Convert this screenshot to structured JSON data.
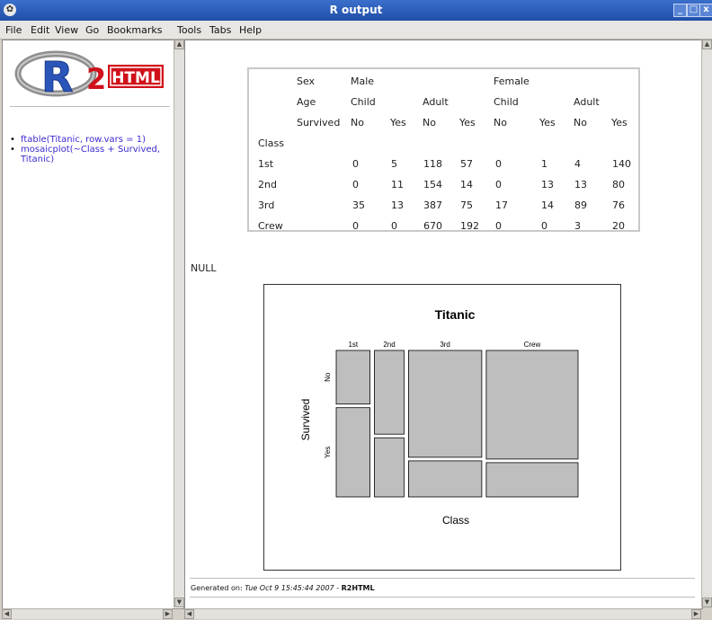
{
  "window": {
    "title": "R output",
    "buttons": [
      "_",
      "□",
      "x"
    ]
  },
  "menu": [
    "File",
    "Edit",
    "View",
    "Go",
    "Bookmarks",
    "Tools",
    "Tabs",
    "Help"
  ],
  "logo": {
    "r": "R",
    "two": "2",
    "html": "HTML"
  },
  "toc": [
    "ftable(Titanic, row.vars = 1)",
    "mosaicplot(~Class + Survived, Titanic)"
  ],
  "table": {
    "header_rows": [
      [
        "Sex",
        "Male",
        "Female"
      ],
      [
        "Age",
        "Child",
        "Adult",
        "Child",
        "Adult"
      ],
      [
        "Survived",
        "No",
        "Yes",
        "No",
        "Yes",
        "No",
        "Yes",
        "No",
        "Yes"
      ]
    ],
    "class_label": "Class",
    "rows": [
      {
        "name": "1st",
        "values": [
          "0",
          "5",
          "118",
          "57",
          "0",
          "1",
          "4",
          "140"
        ]
      },
      {
        "name": "2nd",
        "values": [
          "0",
          "11",
          "154",
          "14",
          "0",
          "13",
          "13",
          "80"
        ]
      },
      {
        "name": "3rd",
        "values": [
          "35",
          "13",
          "387",
          "75",
          "17",
          "14",
          "89",
          "76"
        ]
      },
      {
        "name": "Crew",
        "values": [
          "0",
          "0",
          "670",
          "192",
          "0",
          "0",
          "3",
          "20"
        ]
      }
    ]
  },
  "null_text": "NULL",
  "plot": {
    "title": "Titanic",
    "xlabel": "Class",
    "ylabel": "Survived",
    "x_categories": [
      "1st",
      "2nd",
      "3rd",
      "Crew"
    ],
    "y_categories": [
      "No",
      "Yes"
    ]
  },
  "chart_data": {
    "type": "mosaic",
    "title": "Titanic",
    "xlabel": "Class",
    "ylabel": "Survived",
    "categories": [
      "1st",
      "2nd",
      "3rd",
      "Crew"
    ],
    "series": [
      {
        "name": "No",
        "values": [
          122,
          167,
          528,
          673
        ]
      },
      {
        "name": "Yes",
        "values": [
          203,
          118,
          178,
          212
        ]
      }
    ],
    "fill_color": "#bebebe"
  },
  "footer": {
    "prefix": "Generated on: ",
    "date": "Tue Oct 9 15:45:44 2007",
    "sep": " - ",
    "brand": "R2HTML"
  },
  "colors": {
    "link": "#3a2bd1",
    "titlebar": "#2a5bb8",
    "logo_red": "#d0101a"
  }
}
